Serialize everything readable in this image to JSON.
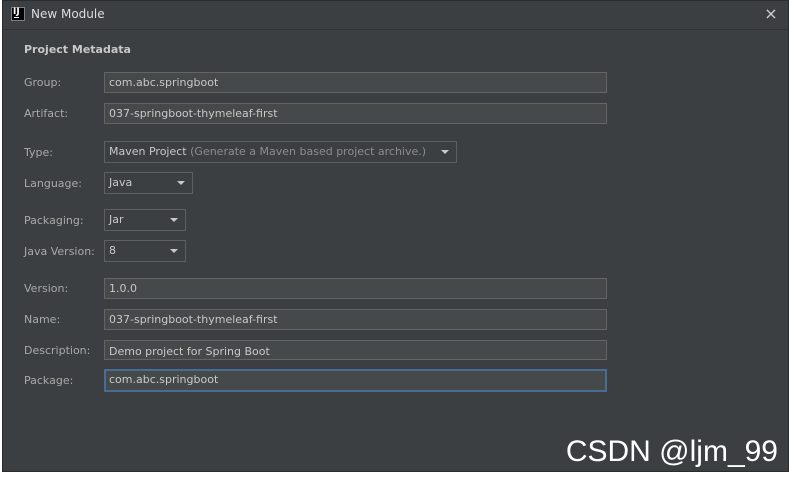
{
  "window": {
    "title": "New Module",
    "close_glyph": "×",
    "app_icon": "intellij-icon"
  },
  "metadata": {
    "section_title": "Project Metadata",
    "group": {
      "label": "Group:",
      "value": "com.abc.springboot"
    },
    "artifact": {
      "label": "Artifact:",
      "value": "037-springboot-thymeleaf-first"
    },
    "type": {
      "label": "Type:",
      "value": "Maven Project",
      "hint": "(Generate a Maven based project archive.)"
    },
    "language": {
      "label": "Language:",
      "value": "Java"
    },
    "packaging": {
      "label": "Packaging:",
      "value": "Jar"
    },
    "java_version": {
      "label": "Java Version:",
      "value": "8"
    },
    "version": {
      "label": "Version:",
      "value": "1.0.0"
    },
    "name": {
      "label": "Name:",
      "value": "037-springboot-thymeleaf-first"
    },
    "description": {
      "label": "Description:",
      "value": "Demo project for Spring Boot"
    },
    "package": {
      "label": "Package:",
      "value": "com.abc.springboot"
    }
  },
  "watermark": "CSDN @ljm_99",
  "colors": {
    "background": "#3c3f41",
    "field_background": "#45494a",
    "focus_border": "#466d94",
    "text": "#bbbbbb"
  }
}
